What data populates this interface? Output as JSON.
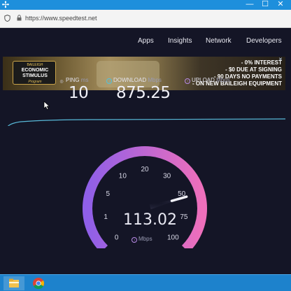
{
  "window": {
    "left_icon": "✢",
    "min": "—",
    "max": "☐",
    "close": "✕"
  },
  "browser": {
    "url": "https://www.speedtest.net"
  },
  "nav": [
    "Apps",
    "Insights",
    "Network",
    "Developers"
  ],
  "ad": {
    "brand": "BAILEIGH",
    "headline_1": "ECONOMIC",
    "headline_2": "STIMULUS",
    "tagline": "Program",
    "close": "✕",
    "lines": [
      "- 0% INTEREST",
      "- $0 DUE AT SIGNING",
      "- 90 DAYS NO PAYMENTS",
      "- ON NEW BAILEIGH EQUIPMENT"
    ]
  },
  "metrics": {
    "ping": {
      "label": "PING",
      "unit": "ms",
      "value": "10",
      "icon": "ping-icon"
    },
    "download": {
      "label": "DOWNLOAD",
      "unit": "Mbps",
      "value": "875.25",
      "icon": "download-icon"
    },
    "upload": {
      "label": "UPLOAD",
      "unit": "Mbps",
      "icon": "upload-icon"
    }
  },
  "gauge": {
    "ticks": [
      "0",
      "1",
      "5",
      "10",
      "20",
      "30",
      "50",
      "75",
      "100"
    ],
    "current_value": "113.02",
    "current_numeric": 113.02,
    "unit": "Mbps",
    "arc_start_color": "#8f5fe8",
    "arc_end_color": "#ee6fbb"
  },
  "taskbar": {
    "apps": [
      "file-explorer-icon",
      "chrome-icon"
    ]
  }
}
